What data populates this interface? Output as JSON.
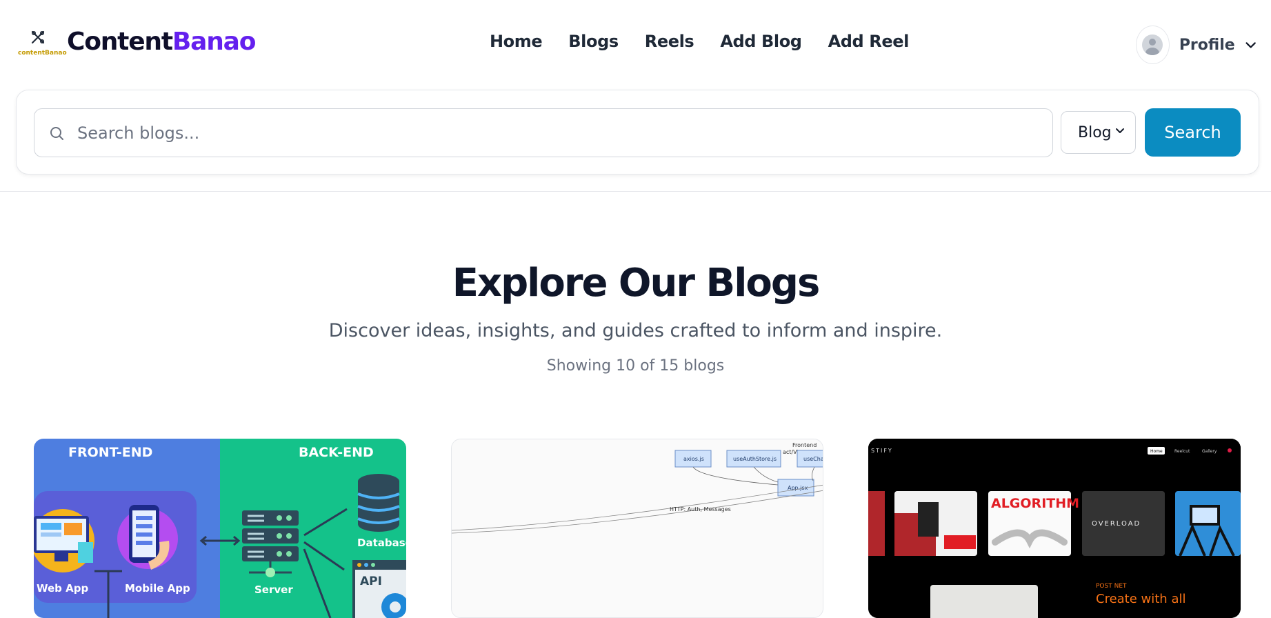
{
  "brand": {
    "logo_subtext": "contentBanao",
    "name_part1": "Content",
    "name_part2": "Banao",
    "accent_color": "#6420ee"
  },
  "nav": {
    "links": [
      "Home",
      "Blogs",
      "Reels",
      "Add Blog",
      "Add Reel"
    ]
  },
  "profile": {
    "label": "Profile"
  },
  "search": {
    "placeholder": "Search blogs...",
    "type_selected": "Blog",
    "button_label": "Search",
    "button_color": "#0b8cc1"
  },
  "hero": {
    "title": "Explore Our Blogs",
    "subtitle": "Discover ideas, insights, and guides crafted to inform and inspire.",
    "count_text": "Showing 10 of 15 blogs"
  },
  "cards": [
    {
      "labels": {
        "front_end": "FRONT-END",
        "back_end": "BACK-END",
        "web_app": "Web App",
        "mobile_app": "Mobile App",
        "server": "Server",
        "database": "Database",
        "api": "API"
      }
    },
    {
      "labels": {
        "frontend": "Frontend",
        "frontend_sub": "act/Vi",
        "node1": "axios.js",
        "node2": "useAuthStore.js",
        "node3": "useChat",
        "node4": "App.jsx",
        "edge": "HTTP: Auth, Messages"
      }
    },
    {
      "labels": {
        "brand": "STIFY",
        "nav1": "Home",
        "nav2": "Reelcut",
        "nav3": "Gallery",
        "tile1": "ALGORITHM",
        "tile2": "OVERLOAD",
        "post_tag": "POST NET",
        "headline": "Create with all"
      }
    }
  ]
}
